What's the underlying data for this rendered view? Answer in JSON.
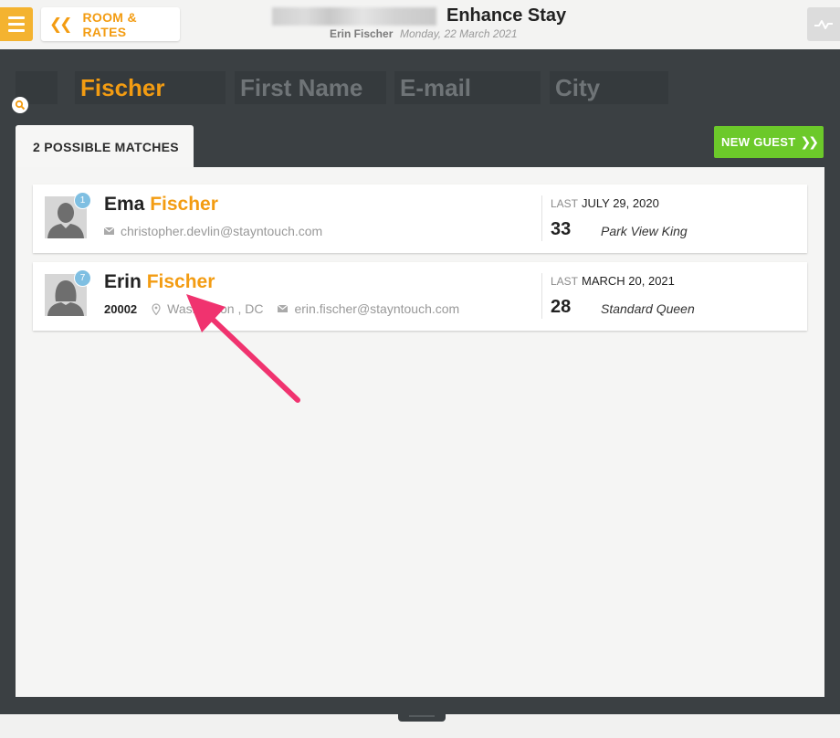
{
  "header": {
    "back_label": "ROOM & RATES",
    "title": "Enhance Stay",
    "guest_name": "Erin Fischer",
    "date": "Monday, 22 March 2021"
  },
  "search": {
    "last_name_value": "Fischer",
    "first_name_placeholder": "First Name",
    "email_placeholder": "E-mail",
    "city_placeholder": "City"
  },
  "results": {
    "tab_label": "2 POSSIBLE MATCHES",
    "new_guest_label": "NEW GUEST",
    "guests": [
      {
        "badge": "1",
        "first_name": "Ema",
        "last_name": "Fischer",
        "email": "christopher.devlin@stayntouch.com",
        "last_label": "LAST",
        "last_date": "JULY 29, 2020",
        "room_no": "33",
        "room_type": "Park View King"
      },
      {
        "badge": "7",
        "first_name": "Erin",
        "last_name": "Fischer",
        "zip": "20002",
        "location": "Washington , DC",
        "email": "erin.fischer@stayntouch.com",
        "last_label": "LAST",
        "last_date": "MARCH 20, 2021",
        "room_no": "28",
        "room_type": "Standard Queen"
      }
    ]
  },
  "colors": {
    "accent": "#f39c12",
    "menu": "#f4b330",
    "new_guest": "#6cc92a",
    "dark_bg": "#3b4043",
    "badge": "#7fbfe2",
    "annotation_arrow": "#f0336f"
  },
  "icons": [
    "menu-icon",
    "double-chevron-left-icon",
    "activity-icon",
    "search-icon",
    "double-chevron-right-icon",
    "envelope-icon",
    "map-pin-icon",
    "male-avatar-icon",
    "female-avatar-icon"
  ]
}
